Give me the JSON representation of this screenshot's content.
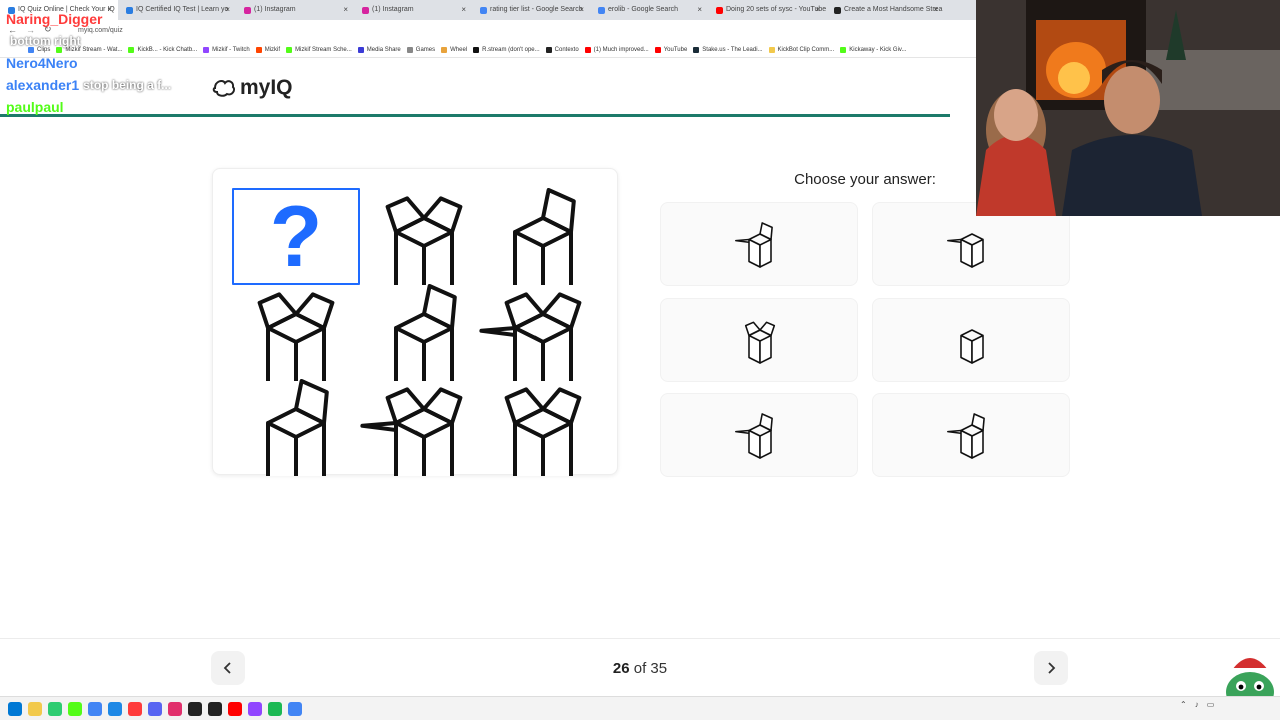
{
  "browser": {
    "tabs": [
      {
        "title": "IQ Quiz Online | Check Your IQ",
        "color": "#2a7de1",
        "active": true
      },
      {
        "title": "IQ Certified IQ Test | Learn yo",
        "color": "#2a7de1"
      },
      {
        "title": "(1) Instagram",
        "color": "#d6249f"
      },
      {
        "title": "(1) Instagram",
        "color": "#d6249f"
      },
      {
        "title": "rating tier list - Google Search",
        "color": "#4285f4"
      },
      {
        "title": "erolib - Google Search",
        "color": "#4285f4"
      },
      {
        "title": "Doing 20 sets of sysc - YouTube",
        "color": "#ff0000"
      },
      {
        "title": "Create a Most Handsome Strea",
        "color": "#222222"
      }
    ],
    "url": "myiq.com/quiz",
    "bookmarks": [
      {
        "label": "Clips",
        "color": "#4285f4"
      },
      {
        "label": "Mizkif Stream - Wat...",
        "color": "#53fc18"
      },
      {
        "label": "KickB... - Kick Chatb...",
        "color": "#53fc18"
      },
      {
        "label": "Mizkif - Twitch",
        "color": "#9146ff"
      },
      {
        "label": "Mizkif",
        "color": "#ff4500"
      },
      {
        "label": "Mizkif Stream Sche...",
        "color": "#53fc18"
      },
      {
        "label": "Media Share",
        "color": "#3b3bd6"
      },
      {
        "label": "Games",
        "color": "#888888"
      },
      {
        "label": "Wheel",
        "color": "#e8a33c"
      },
      {
        "label": "R.stream (don't ope...",
        "color": "#111111"
      },
      {
        "label": "Contexto",
        "color": "#222222"
      },
      {
        "label": "(1) Much improved...",
        "color": "#ff0000"
      },
      {
        "label": "YouTube",
        "color": "#ff0000"
      },
      {
        "label": "Stake.us - The Leadi...",
        "color": "#1a2c38"
      },
      {
        "label": "KickBot Clip Comm...",
        "color": "#f2c94c"
      },
      {
        "label": "Kickaway - Kick Giv...",
        "color": "#53fc18"
      }
    ]
  },
  "site": {
    "logo": "myIQ",
    "accent": "#1e6bff",
    "progress_color": "#1d7a6a"
  },
  "quiz": {
    "question_mark": "?",
    "choose_label": "Choose your answer:",
    "current": "26",
    "of_label": "of",
    "total": "35",
    "prev_icon": "chevron-left-icon",
    "next_icon": "chevron-right-icon"
  },
  "chat": [
    {
      "user": "Naring_Digger",
      "user_color": "#ff3b3b",
      "text": ""
    },
    {
      "user": "",
      "user_color": "#53fc18",
      "text": "bottom right"
    },
    {
      "user": "Nero4Nero",
      "user_color": "#3b82f6",
      "text": ""
    },
    {
      "user": "alexander1",
      "user_color": "#3b82f6",
      "text": "stop being a f..."
    },
    {
      "user": "paulpaul",
      "user_color": "#53fc18",
      "text": ""
    }
  ]
}
